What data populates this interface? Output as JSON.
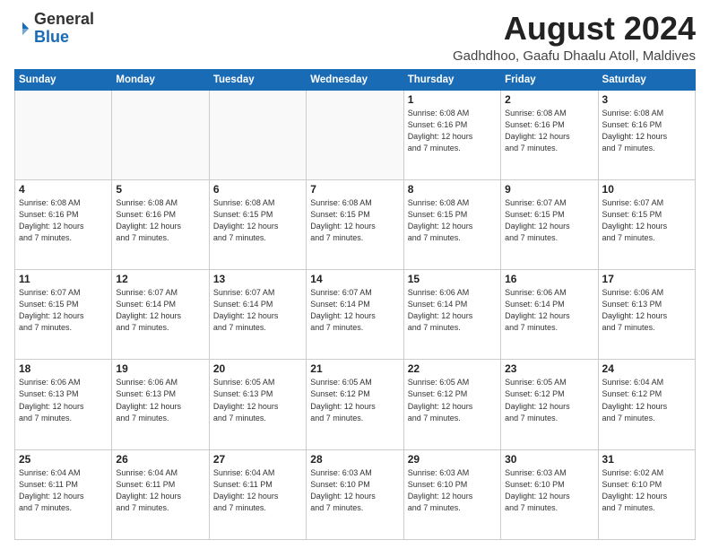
{
  "header": {
    "logo_general": "General",
    "logo_blue": "Blue",
    "month_year": "August 2024",
    "location": "Gadhdhoo, Gaafu Dhaalu Atoll, Maldives"
  },
  "weekdays": [
    "Sunday",
    "Monday",
    "Tuesday",
    "Wednesday",
    "Thursday",
    "Friday",
    "Saturday"
  ],
  "weeks": [
    [
      {
        "day": "",
        "info": ""
      },
      {
        "day": "",
        "info": ""
      },
      {
        "day": "",
        "info": ""
      },
      {
        "day": "",
        "info": ""
      },
      {
        "day": "1",
        "info": "Sunrise: 6:08 AM\nSunset: 6:16 PM\nDaylight: 12 hours\nand 7 minutes."
      },
      {
        "day": "2",
        "info": "Sunrise: 6:08 AM\nSunset: 6:16 PM\nDaylight: 12 hours\nand 7 minutes."
      },
      {
        "day": "3",
        "info": "Sunrise: 6:08 AM\nSunset: 6:16 PM\nDaylight: 12 hours\nand 7 minutes."
      }
    ],
    [
      {
        "day": "4",
        "info": "Sunrise: 6:08 AM\nSunset: 6:16 PM\nDaylight: 12 hours\nand 7 minutes."
      },
      {
        "day": "5",
        "info": "Sunrise: 6:08 AM\nSunset: 6:16 PM\nDaylight: 12 hours\nand 7 minutes."
      },
      {
        "day": "6",
        "info": "Sunrise: 6:08 AM\nSunset: 6:15 PM\nDaylight: 12 hours\nand 7 minutes."
      },
      {
        "day": "7",
        "info": "Sunrise: 6:08 AM\nSunset: 6:15 PM\nDaylight: 12 hours\nand 7 minutes."
      },
      {
        "day": "8",
        "info": "Sunrise: 6:08 AM\nSunset: 6:15 PM\nDaylight: 12 hours\nand 7 minutes."
      },
      {
        "day": "9",
        "info": "Sunrise: 6:07 AM\nSunset: 6:15 PM\nDaylight: 12 hours\nand 7 minutes."
      },
      {
        "day": "10",
        "info": "Sunrise: 6:07 AM\nSunset: 6:15 PM\nDaylight: 12 hours\nand 7 minutes."
      }
    ],
    [
      {
        "day": "11",
        "info": "Sunrise: 6:07 AM\nSunset: 6:15 PM\nDaylight: 12 hours\nand 7 minutes."
      },
      {
        "day": "12",
        "info": "Sunrise: 6:07 AM\nSunset: 6:14 PM\nDaylight: 12 hours\nand 7 minutes."
      },
      {
        "day": "13",
        "info": "Sunrise: 6:07 AM\nSunset: 6:14 PM\nDaylight: 12 hours\nand 7 minutes."
      },
      {
        "day": "14",
        "info": "Sunrise: 6:07 AM\nSunset: 6:14 PM\nDaylight: 12 hours\nand 7 minutes."
      },
      {
        "day": "15",
        "info": "Sunrise: 6:06 AM\nSunset: 6:14 PM\nDaylight: 12 hours\nand 7 minutes."
      },
      {
        "day": "16",
        "info": "Sunrise: 6:06 AM\nSunset: 6:14 PM\nDaylight: 12 hours\nand 7 minutes."
      },
      {
        "day": "17",
        "info": "Sunrise: 6:06 AM\nSunset: 6:13 PM\nDaylight: 12 hours\nand 7 minutes."
      }
    ],
    [
      {
        "day": "18",
        "info": "Sunrise: 6:06 AM\nSunset: 6:13 PM\nDaylight: 12 hours\nand 7 minutes."
      },
      {
        "day": "19",
        "info": "Sunrise: 6:06 AM\nSunset: 6:13 PM\nDaylight: 12 hours\nand 7 minutes."
      },
      {
        "day": "20",
        "info": "Sunrise: 6:05 AM\nSunset: 6:13 PM\nDaylight: 12 hours\nand 7 minutes."
      },
      {
        "day": "21",
        "info": "Sunrise: 6:05 AM\nSunset: 6:12 PM\nDaylight: 12 hours\nand 7 minutes."
      },
      {
        "day": "22",
        "info": "Sunrise: 6:05 AM\nSunset: 6:12 PM\nDaylight: 12 hours\nand 7 minutes."
      },
      {
        "day": "23",
        "info": "Sunrise: 6:05 AM\nSunset: 6:12 PM\nDaylight: 12 hours\nand 7 minutes."
      },
      {
        "day": "24",
        "info": "Sunrise: 6:04 AM\nSunset: 6:12 PM\nDaylight: 12 hours\nand 7 minutes."
      }
    ],
    [
      {
        "day": "25",
        "info": "Sunrise: 6:04 AM\nSunset: 6:11 PM\nDaylight: 12 hours\nand 7 minutes."
      },
      {
        "day": "26",
        "info": "Sunrise: 6:04 AM\nSunset: 6:11 PM\nDaylight: 12 hours\nand 7 minutes."
      },
      {
        "day": "27",
        "info": "Sunrise: 6:04 AM\nSunset: 6:11 PM\nDaylight: 12 hours\nand 7 minutes."
      },
      {
        "day": "28",
        "info": "Sunrise: 6:03 AM\nSunset: 6:10 PM\nDaylight: 12 hours\nand 7 minutes."
      },
      {
        "day": "29",
        "info": "Sunrise: 6:03 AM\nSunset: 6:10 PM\nDaylight: 12 hours\nand 7 minutes."
      },
      {
        "day": "30",
        "info": "Sunrise: 6:03 AM\nSunset: 6:10 PM\nDaylight: 12 hours\nand 7 minutes."
      },
      {
        "day": "31",
        "info": "Sunrise: 6:02 AM\nSunset: 6:10 PM\nDaylight: 12 hours\nand 7 minutes."
      }
    ]
  ]
}
